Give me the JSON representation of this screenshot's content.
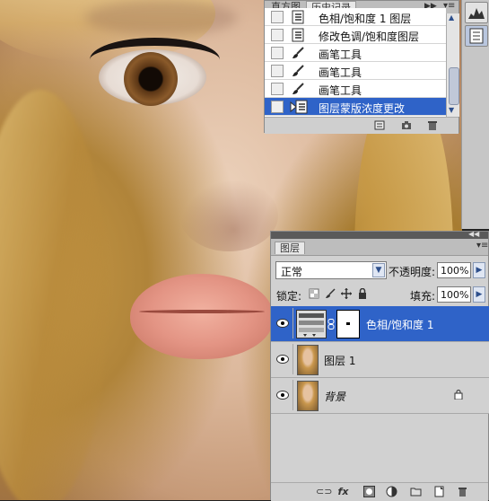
{
  "history_panel": {
    "tabs": [
      "直方图",
      "历史记录"
    ],
    "items": [
      {
        "label": "色相/饱和度 1 图层",
        "icon": "adjustment-layer-icon"
      },
      {
        "label": "修改色调/饱和度图层",
        "icon": "adjustment-layer-icon"
      },
      {
        "label": "画笔工具",
        "icon": "brush-icon"
      },
      {
        "label": "画笔工具",
        "icon": "brush-icon"
      },
      {
        "label": "画笔工具",
        "icon": "brush-icon"
      },
      {
        "label": "图层蒙版浓度更改",
        "icon": "adjustment-layer-icon",
        "selected": true
      }
    ]
  },
  "layers_panel": {
    "tab": "图层",
    "blend_mode": "正常",
    "opacity_label": "不透明度:",
    "opacity_value": "100%",
    "lock_label": "锁定:",
    "fill_label": "填充:",
    "fill_value": "100%",
    "layers": [
      {
        "name": "色相/饱和度 1",
        "type": "adjustment",
        "selected": true
      },
      {
        "name": "图层 1",
        "type": "pixel"
      },
      {
        "name": "背景",
        "type": "background",
        "locked": true
      }
    ]
  },
  "colors": {
    "selection": "#2f63c8",
    "panel_bg": "#d1d1d1"
  }
}
